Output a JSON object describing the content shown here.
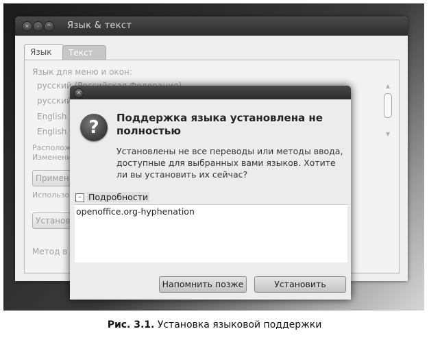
{
  "background_window": {
    "title": "Язык & текст",
    "tabs": [
      "Язык",
      "Текст"
    ],
    "language_label": "Язык для меню и окон:",
    "language_items": [
      "русский (Российская Федерация)",
      "русский",
      "English (",
      "English"
    ],
    "location_text_1": "Располож",
    "location_text_2": "Изменени",
    "apply_button": "Примен",
    "use_text": "Использов",
    "install_button": "Установ",
    "method_text": "Метод в"
  },
  "dialog": {
    "heading": "Поддержка языка установлена не полностью",
    "body": "Установлены не все переводы или методы ввода, доступные для выбранных вами языков. Хотите ли вы установить их сейчас?",
    "details_label": "Подробности",
    "expander_glyph": "–",
    "details_content": "openoffice.org-hyphenation",
    "remind_button": "Напомнить позже",
    "install_button": "Установить",
    "question_icon": "?"
  },
  "caption": {
    "label": "Рис. 3.1.",
    "text": "Установка языковой поддержки"
  }
}
